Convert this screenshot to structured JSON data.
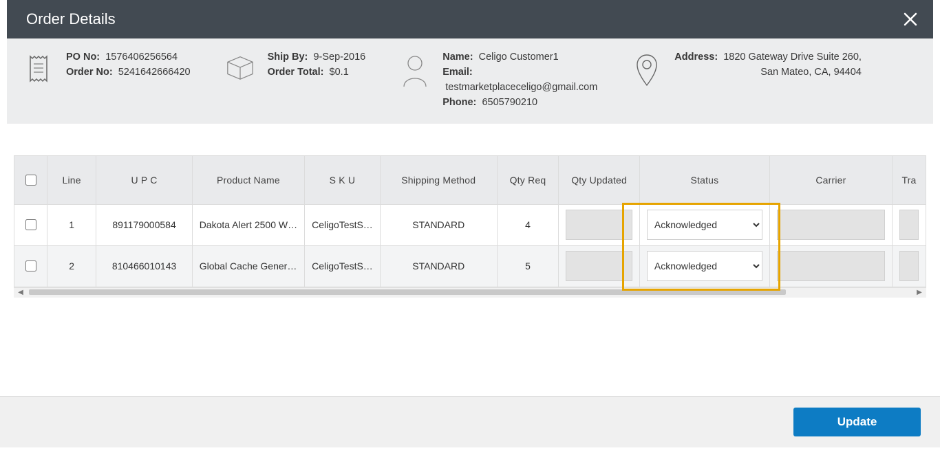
{
  "modal": {
    "title": "Order Details"
  },
  "summary": {
    "po_label": "PO No:",
    "po_value": "1576406256564",
    "order_label": "Order No:",
    "order_value": "5241642666420",
    "shipby_label": "Ship By:",
    "shipby_value": "9-Sep-2016",
    "total_label": "Order Total:",
    "total_value": "$0.1",
    "name_label": "Name:",
    "name_value": "Celigo Customer1",
    "email_label": "Email:",
    "email_value": "testmarketplaceceligo@gmail.com",
    "phone_label": "Phone:",
    "phone_value": "6505790210",
    "address_label": "Address:",
    "address_line1": "1820 Gateway Drive Suite 260,",
    "address_line2": "San Mateo, CA, 94404"
  },
  "table": {
    "headers": {
      "check": "",
      "line": "Line",
      "upc": "U P C",
      "product": "Product Name",
      "sku": "S K U",
      "shipping": "Shipping Method",
      "qtyreq": "Qty Req",
      "qtyupd": "Qty Updated",
      "status": "Status",
      "carrier": "Carrier",
      "tracking": "Tra"
    },
    "rows": [
      {
        "line": "1",
        "upc": "891179000584",
        "product": "Dakota Alert 2500 W…",
        "sku": "CeligoTestS…",
        "shipping": "STANDARD",
        "qtyreq": "4",
        "status": "Acknowledged"
      },
      {
        "line": "2",
        "upc": "810466010143",
        "product": "Global Cache Gener…",
        "sku": "CeligoTestS…",
        "shipping": "STANDARD",
        "qtyreq": "5",
        "status": "Acknowledged"
      }
    ]
  },
  "footer": {
    "update_label": "Update"
  }
}
